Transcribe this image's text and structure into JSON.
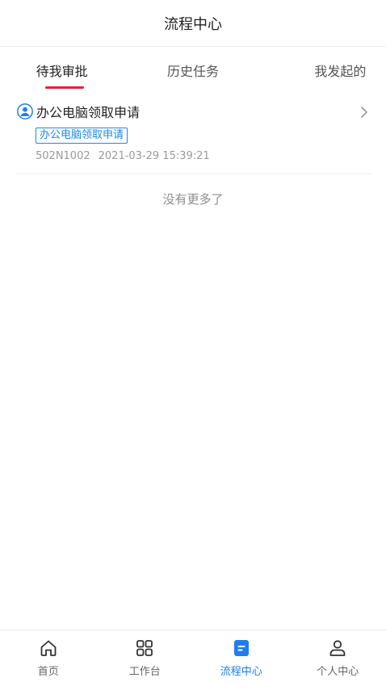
{
  "header": {
    "title": "流程中心"
  },
  "tabs": [
    {
      "label": "待我审批",
      "active": true
    },
    {
      "label": "历史任务",
      "active": false
    },
    {
      "label": "我发起的",
      "active": false
    }
  ],
  "tasks": [
    {
      "title": "办公电脑领取申请",
      "tag": "办公电脑领取申请",
      "code": "502N1002",
      "time": "2021-03-29 15:39:21"
    }
  ],
  "list_footer": "没有更多了",
  "bottom_nav": [
    {
      "label": "首页",
      "icon": "home-icon",
      "active": false
    },
    {
      "label": "工作台",
      "icon": "grid-icon",
      "active": false
    },
    {
      "label": "流程中心",
      "icon": "document-icon",
      "active": true
    },
    {
      "label": "个人中心",
      "icon": "person-icon",
      "active": false
    }
  ],
  "colors": {
    "accent_red": "#e0243a",
    "accent_blue": "#1e7df0",
    "muted_text": "#9a9a9a"
  }
}
